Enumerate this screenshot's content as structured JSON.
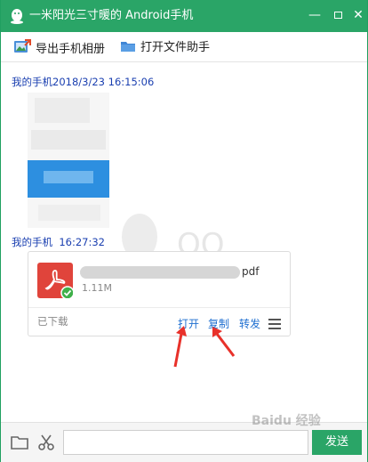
{
  "window": {
    "title": "一米阳光三寸暖的 Android手机",
    "controls": {
      "minimize": "—",
      "close": "✕"
    },
    "colors": {
      "accent": "#2aa567",
      "link": "#1f6fd0",
      "sender": "#1a3fb0"
    }
  },
  "toolbar": {
    "export_label": "导出手机相册",
    "file_helper_label": "打开文件助手"
  },
  "chat": {
    "watermark": "QQ",
    "messages": [
      {
        "sender": "我的手机",
        "timestamp": "2018/3/23 16:15:06",
        "content_type": "image"
      },
      {
        "sender": "我的手机",
        "timestamp": "16:27:32",
        "content_type": "file",
        "file": {
          "ext_label": "pdf",
          "size": "1.11M",
          "status": "已下载",
          "actions": {
            "open": "打开",
            "copy": "复制",
            "forward": "转发"
          }
        }
      }
    ]
  },
  "inputbar": {
    "placeholder": "",
    "send_label": "发送"
  },
  "overlay": {
    "site_watermark": "Baidu 经验"
  }
}
